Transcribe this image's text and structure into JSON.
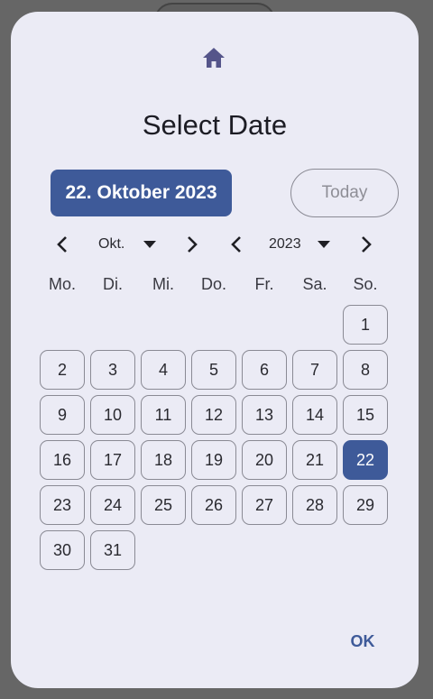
{
  "dialog": {
    "title": "Select Date",
    "selected_date_label": "22. Oktober 2023",
    "today_label": "Today",
    "ok_label": "OK",
    "home_icon": "home-icon"
  },
  "navigation": {
    "month": "Okt.",
    "year": "2023",
    "prev_icon": "chevron-left-icon",
    "next_icon": "chevron-right-icon",
    "dropdown_icon": "caret-down-icon"
  },
  "weekdays": [
    "Mo.",
    "Di.",
    "Mi.",
    "Do.",
    "Fr.",
    "Sa.",
    "So."
  ],
  "calendar": {
    "first_weekday_index": 6,
    "days": [
      "1",
      "2",
      "3",
      "4",
      "5",
      "6",
      "7",
      "8",
      "9",
      "10",
      "11",
      "12",
      "13",
      "14",
      "15",
      "16",
      "17",
      "18",
      "19",
      "20",
      "21",
      "22",
      "23",
      "24",
      "25",
      "26",
      "27",
      "28",
      "29",
      "30",
      "31"
    ],
    "selected_day": "22"
  },
  "colors": {
    "accent": "#3e5a99",
    "dialog_background": "#ebebf5",
    "scrim": "#666666"
  }
}
